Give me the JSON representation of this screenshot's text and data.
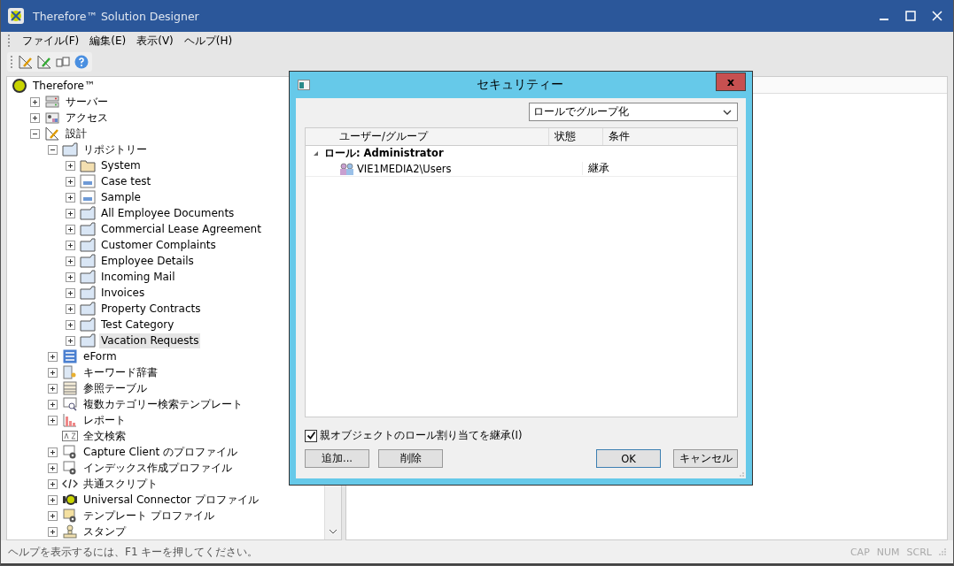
{
  "window": {
    "title": "Therefore™ Solution Designer"
  },
  "menu": [
    {
      "label": "ファイル(F)"
    },
    {
      "label": "編集(E)"
    },
    {
      "label": "表示(V)"
    },
    {
      "label": "ヘルプ(H)"
    }
  ],
  "toolbar": [
    {
      "kind": "design"
    },
    {
      "kind": "design-refresh"
    },
    {
      "kind": "translate"
    },
    {
      "kind": "help"
    }
  ],
  "tree": [
    {
      "label": "Therefore™",
      "kind": "root",
      "selected": false,
      "children": [
        {
          "label": "サーバー",
          "kind": "server",
          "expanded": false,
          "selected": false
        },
        {
          "label": "アクセス",
          "kind": "access",
          "expanded": false,
          "selected": false
        },
        {
          "label": "設計",
          "kind": "design",
          "expanded": true,
          "selected": false,
          "children": [
            {
              "label": "リポジトリー",
              "kind": "repository",
              "expanded": true,
              "selected": false,
              "children": [
                {
                  "label": "System",
                  "kind": "folder-tan",
                  "expanded": false,
                  "selected": false
                },
                {
                  "label": "Case test",
                  "kind": "case",
                  "expanded": false,
                  "selected": false
                },
                {
                  "label": "Sample",
                  "kind": "case",
                  "expanded": false,
                  "selected": false
                },
                {
                  "label": "All Employee Documents",
                  "kind": "folder",
                  "expanded": false,
                  "selected": false
                },
                {
                  "label": "Commercial Lease Agreement",
                  "kind": "folder",
                  "expanded": false,
                  "selected": false
                },
                {
                  "label": "Customer Complaints",
                  "kind": "folder",
                  "expanded": false,
                  "selected": false
                },
                {
                  "label": "Employee Details",
                  "kind": "folder",
                  "expanded": false,
                  "selected": false
                },
                {
                  "label": "Incoming Mail",
                  "kind": "folder",
                  "expanded": false,
                  "selected": false
                },
                {
                  "label": "Invoices",
                  "kind": "folder",
                  "expanded": false,
                  "selected": false
                },
                {
                  "label": "Property Contracts",
                  "kind": "folder",
                  "expanded": false,
                  "selected": false
                },
                {
                  "label": "Test Category",
                  "kind": "folder",
                  "expanded": false,
                  "selected": false
                },
                {
                  "label": "Vacation Requests",
                  "kind": "folder",
                  "expanded": false,
                  "selected": true
                }
              ]
            },
            {
              "label": "eForm",
              "kind": "eform",
              "expanded": false,
              "selected": false
            },
            {
              "label": "キーワード辞書",
              "kind": "keyword",
              "expanded": false,
              "selected": false
            },
            {
              "label": "参照テーブル",
              "kind": "table",
              "expanded": false,
              "selected": false
            },
            {
              "label": "複数カテゴリー検索テンプレート",
              "kind": "search-template",
              "expanded": false,
              "selected": false
            },
            {
              "label": "レポート",
              "kind": "report",
              "expanded": false,
              "selected": false
            },
            {
              "label": "全文検索",
              "kind": "fulltext",
              "leaf": true,
              "selected": false
            },
            {
              "label": "Capture Client のプロファイル",
              "kind": "profile",
              "expanded": false,
              "selected": false
            },
            {
              "label": "インデックス作成プロファイル",
              "kind": "profile",
              "expanded": false,
              "selected": false
            },
            {
              "label": "共通スクリプト",
              "kind": "script",
              "expanded": false,
              "selected": false
            },
            {
              "label": "Universal Connector プロファイル",
              "kind": "connector",
              "expanded": false,
              "selected": false
            },
            {
              "label": "テンプレート プロファイル",
              "kind": "template",
              "expanded": false,
              "selected": false
            },
            {
              "label": "スタンプ",
              "kind": "stamp",
              "expanded": false,
              "selected": false
            }
          ]
        }
      ]
    }
  ],
  "dialog": {
    "title": "セキュリティー",
    "close": "x",
    "group_by": {
      "value": "ロールでグループ化"
    },
    "columns": [
      "ユーザー/グループ",
      "状態",
      "条件"
    ],
    "groups": [
      {
        "label": "ロール: Administrator",
        "expanded": true,
        "rows": [
          {
            "name": "VIE1MEDIA2\\Users",
            "state": "継承"
          }
        ]
      }
    ],
    "inherit": {
      "label": "親オブジェクトのロール割り当てを継承(I)",
      "checked": true
    },
    "buttons": [
      {
        "label": "追加...",
        "kind": "left"
      },
      {
        "label": "削除",
        "kind": "left"
      },
      {
        "label": "OK",
        "kind": "default"
      },
      {
        "label": "キャンセル",
        "kind": "right"
      }
    ]
  },
  "status_bar": {
    "message": "ヘルプを表示するには、F1 キーを押してください。",
    "indicators": [
      "CAP",
      "NUM",
      "SCRL"
    ]
  }
}
